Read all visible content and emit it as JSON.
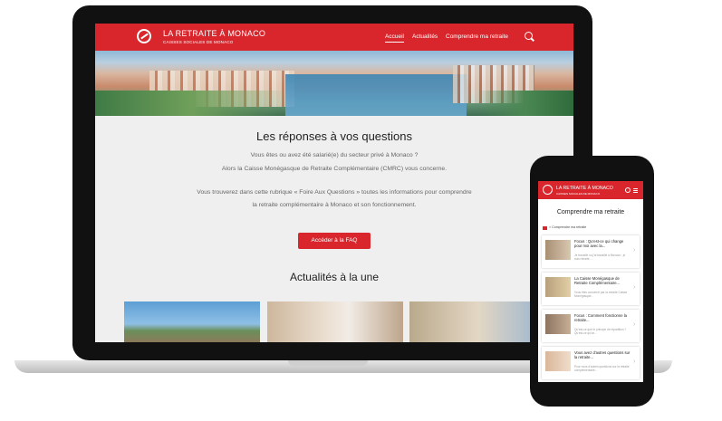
{
  "site": {
    "brand_title": "LA RETRAITE À MONACO",
    "brand_subtitle": "CAISSES SOCIALES DE MONACO"
  },
  "nav": {
    "items": [
      {
        "label": "Accueil",
        "active": true
      },
      {
        "label": "Actualités",
        "active": false
      },
      {
        "label": "Comprendre ma retraite",
        "active": false
      }
    ]
  },
  "main": {
    "title": "Les réponses à vos questions",
    "intro_line1": "Vous êtes ou avez été salarié(e) du secteur privé à Monaco ?",
    "intro_line2": "Alors la Caisse Monégasque de Retraite Complémentaire (CMRC) vous concerne.",
    "faq_line1": "Vous trouverez dans cette rubrique « Foire Aux Questions » toutes les informations pour comprendre",
    "faq_line2": "la retraite complémentaire à Monaco et son fonctionnement.",
    "cta_label": "Accéder à la FAQ",
    "news_title": "Actualités à la une"
  },
  "mobile": {
    "page_title": "Comprendre ma retraite",
    "breadcrumb": "> Comprendre ma retraite",
    "cards": [
      {
        "title": "Focus : Qu'est-ce qui change pour moi avec la...",
        "excerpt": "Je travaille ou j'ai travaillé à Monaco : je suis retraité ..."
      },
      {
        "title": "La Caisse Monégasque de Retraite Complémentaire...",
        "excerpt": "Vous êtes concerné par la retraite Caisse Monégasque..."
      },
      {
        "title": "Focus : Comment fonctionne la retraite...",
        "excerpt": "Qu'est-ce que le principe de répartition ? Qu'est-ce qu'un..."
      },
      {
        "title": "Vous avez d'autres questions sur la retraite...",
        "excerpt": "Pour nous d'autres questions sur la retraite complémentaire..."
      }
    ]
  },
  "colors": {
    "brand_red": "#d8262c",
    "page_bg": "#efefef",
    "device_frame": "#111111"
  },
  "icons": [
    "logo-icon",
    "search-icon",
    "menu-icon",
    "home-icon",
    "chevron-right-icon"
  ]
}
